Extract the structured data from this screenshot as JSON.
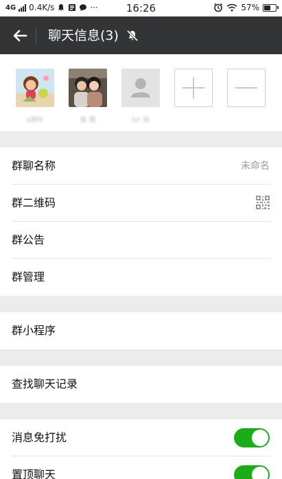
{
  "status_bar": {
    "network": "4G",
    "speed": "0.4K/s",
    "more": "···",
    "time": "16:26",
    "battery": "57%",
    "battery_level": 0.57
  },
  "header": {
    "title": "聊天信息(3)",
    "back_icon": "back-arrow-icon",
    "mute_icon": "bell-muted-icon",
    "bg_color": "#333436"
  },
  "members": [
    {
      "name": "a饼叶"
    },
    {
      "name": "张 熊"
    },
    {
      "name": "Sir 张"
    }
  ],
  "member_actions": {
    "add_icon": "plus-icon",
    "remove_icon": "minus-icon"
  },
  "settings": {
    "group_name": {
      "label": "群聊名称",
      "value": "未命名"
    },
    "qr_code": {
      "label": "群二维码",
      "icon": "qr-code-icon"
    },
    "announcement": {
      "label": "群公告"
    },
    "manage": {
      "label": "群管理"
    },
    "mini_programs": {
      "label": "群小程序"
    },
    "search_history": {
      "label": "查找聊天记录"
    },
    "mute": {
      "label": "消息免打扰",
      "on": true
    },
    "pin": {
      "label": "置顶聊天",
      "on": true
    }
  },
  "colors": {
    "accent": "#1aad19",
    "divider_gap": "#ececec"
  }
}
